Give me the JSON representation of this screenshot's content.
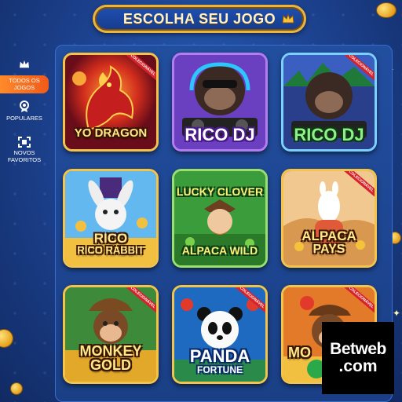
{
  "header": {
    "title": "ESCOLHA SEU JOGO",
    "crown_icon": "crown-icon"
  },
  "sidebar": {
    "items": [
      {
        "label_1": "TODOS OS",
        "label_2": "JOGOS",
        "icon": "crown-icon",
        "active": true
      },
      {
        "label_1": "POPULARES",
        "label_2": "",
        "icon": "badge-icon",
        "active": false
      },
      {
        "label_1": "NOVOS",
        "label_2": "FAVORITOS",
        "icon": "expand-icon",
        "active": false
      }
    ]
  },
  "games": [
    {
      "title_1": "YO DRAGON",
      "title_2": "",
      "ribbon": "COLECIONÁVEL",
      "theme": "dragon"
    },
    {
      "title_1": "RICO DJ",
      "title_2": "",
      "ribbon": "",
      "theme": "gorilla-dj"
    },
    {
      "title_1": "RICO DJ",
      "title_2": "",
      "ribbon": "COLECIONÁVEL",
      "theme": "gorilla-dj-green"
    },
    {
      "title_1": "RICO",
      "title_2": "RICO RABBIT",
      "ribbon": "",
      "theme": "rabbit"
    },
    {
      "title_1": "LUCKY CLOVER",
      "title_2": "ALPACA WILD",
      "ribbon": "",
      "theme": "leprechaun"
    },
    {
      "title_1": "ALPACA",
      "title_2": "PAYS",
      "ribbon": "COLECIONÁVEL",
      "theme": "alpaca"
    },
    {
      "title_1": "MONKEY",
      "title_2": "GOLD",
      "ribbon": "COLECIONÁVEL",
      "theme": "monkey"
    },
    {
      "title_1": "PANDA",
      "title_2": "FORTUNE",
      "ribbon": "COLECIONÁVEL",
      "theme": "panda"
    },
    {
      "title_1": "MO",
      "title_2": "",
      "ribbon": "COLECIONÁVEL",
      "theme": "monkey-partial"
    }
  ],
  "watermark": {
    "line_1": "Betweb",
    "line_2": ".com"
  },
  "colors": {
    "frame_gold": "#f3c34a",
    "sidebar_active": "#f05a1a",
    "background": "#1b3f8a"
  }
}
